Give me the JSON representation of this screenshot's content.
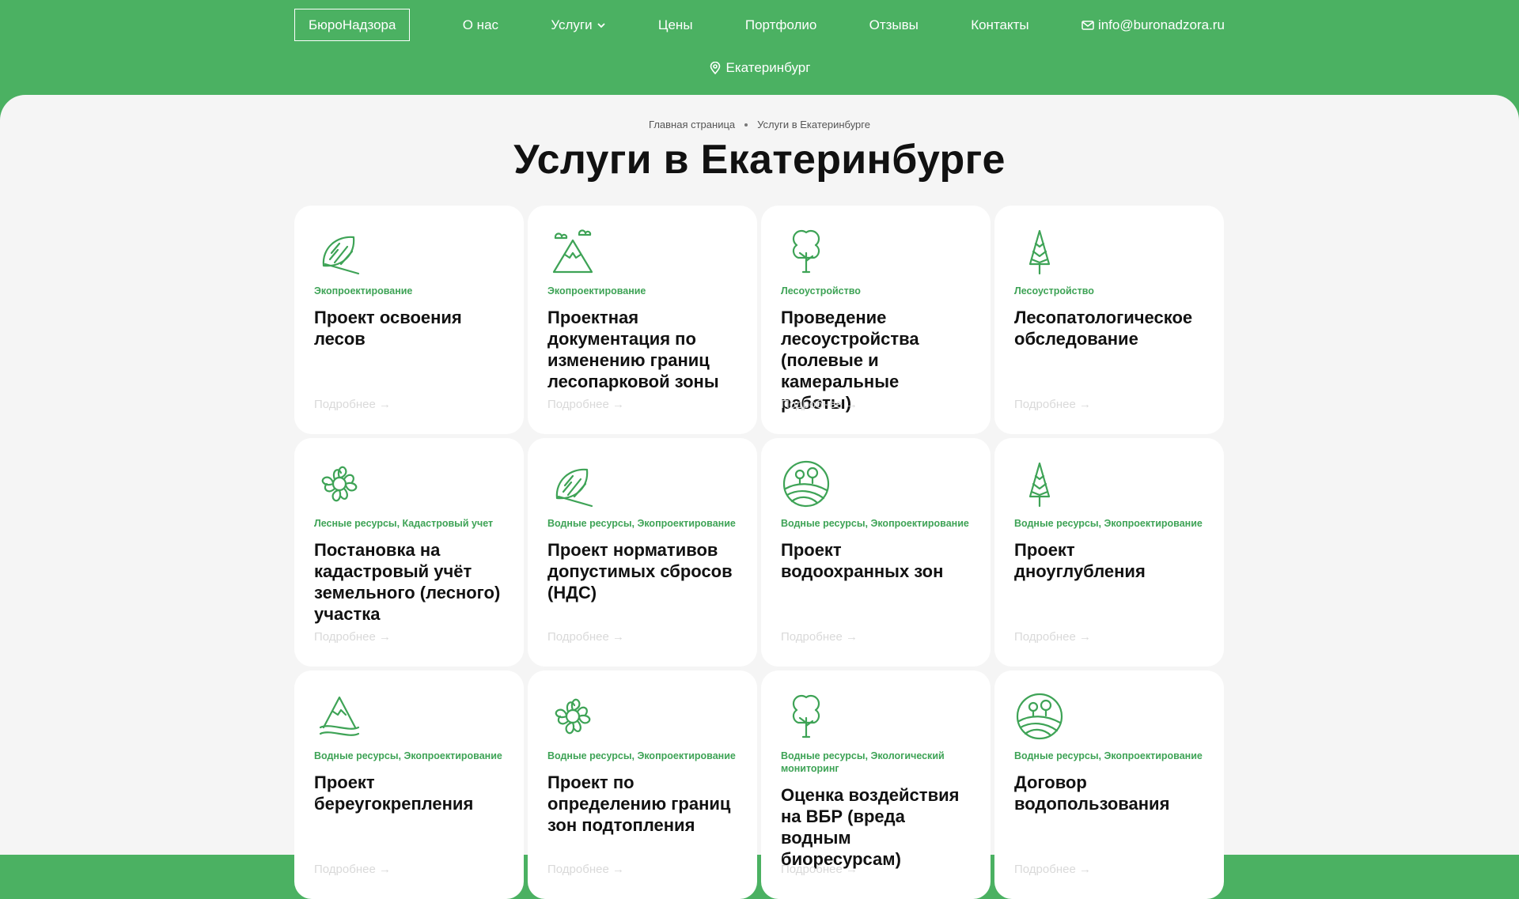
{
  "header": {
    "brand": "БюроНадзора",
    "nav": [
      {
        "label": "О нас"
      },
      {
        "label": "Услуги"
      },
      {
        "label": "Цены"
      },
      {
        "label": "Портфолио"
      },
      {
        "label": "Отзывы"
      },
      {
        "label": "Контакты"
      }
    ],
    "email": "info@buronadzora.ru",
    "city": "Екатеринбург"
  },
  "breadcrumb": {
    "home": "Главная страница",
    "current": "Услуги в Екатеринбурге"
  },
  "page_title": "Услуги в Екатеринбурге",
  "accent_color": "#4bb162",
  "cards": [
    {
      "icon": "leaf-icon",
      "tag": "Экопроектирование",
      "title": "Проект освоения лесов",
      "more": "Подробнее →"
    },
    {
      "icon": "mountain-icon",
      "tag": "Экопроектирование",
      "title": "Проектная документация по изменению границ лесопарковой зоны",
      "more": "Подробнее →"
    },
    {
      "icon": "tree-icon",
      "tag": "Лесоустройство",
      "title": "Проведение лесоустройства (полевые и камеральные работы)",
      "more": "Подробнее →"
    },
    {
      "icon": "fir-tree-icon",
      "tag": "Лесоустройство",
      "title": "Лесопатологическое обследование",
      "more": "Подробнее →"
    },
    {
      "icon": "flower-icon",
      "tag": "Лесные ресурсы, Кадастровый учет",
      "title": "Постановка на кадастровый учёт земельного (лесного) участка",
      "more": "Подробнее →"
    },
    {
      "icon": "leaf-icon",
      "tag": "Водные ресурсы, Экопроектирование",
      "title": "Проект нормативов допустимых сбросов (НДС)",
      "more": "Подробнее →"
    },
    {
      "icon": "field-icon",
      "tag": "Водные ресурсы, Экопроектирование",
      "title": "Проект водоохранных зон",
      "more": "Подробнее →"
    },
    {
      "icon": "fir-tree-icon",
      "tag": "Водные ресурсы, Экопроектирование",
      "title": "Проект дноуглубления",
      "more": "Подробнее →"
    },
    {
      "icon": "mountain-water-icon",
      "tag": "Водные ресурсы, Экопроектирование",
      "title": "Проект береугокрепления",
      "more": "Подробнее →"
    },
    {
      "icon": "flower-icon",
      "tag": "Водные ресурсы, Экопроектирование",
      "title": "Проект по определению границ зон подтопления",
      "more": "Подробнее →"
    },
    {
      "icon": "tree-icon",
      "tag": "Водные ресурсы, Экологический мониторинг",
      "title": "Оценка воздействия на ВБР (вреда водным биоресурсам)",
      "more": "Подробнее →"
    },
    {
      "icon": "field-icon",
      "tag": "Водные ресурсы, Экопроектирование",
      "title": "Договор водопользования",
      "more": "Подробнее →"
    }
  ]
}
